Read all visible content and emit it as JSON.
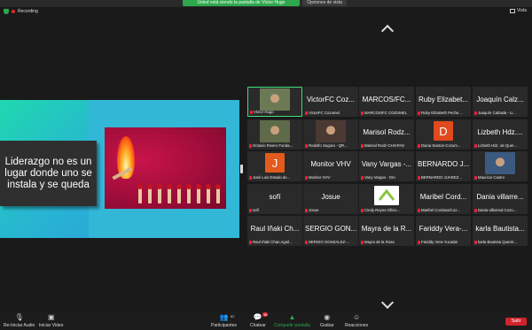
{
  "top": {
    "share_banner": "Usted está viendo la pantalla de Víctor Hugo",
    "view_options": "Opciones de vista",
    "recording": "Recording",
    "view": "Vista"
  },
  "shared_screen": {
    "quote": "Liderazgo no es un lugar donde uno se instala y se queda"
  },
  "participants": [
    {
      "big": "",
      "cap": "Víctor Hugo",
      "type": "video",
      "active": true,
      "color": "#6b7a55"
    },
    {
      "big": "VictorFC Coz...",
      "cap": "VictorFC Cozumel",
      "type": "name"
    },
    {
      "big": "MARCOS/FC...",
      "cap": "MARCOS/FC COZUMEL",
      "type": "name"
    },
    {
      "big": "Ruby Elizabet...",
      "cap": "Ruby Elizabeth Peche...",
      "type": "name"
    },
    {
      "big": "Joaquín Calz...",
      "cap": "Joaquín Calzada - U...",
      "type": "name"
    },
    {
      "big": "",
      "cap": "Octavio Rivero Funda...",
      "type": "video",
      "color": "#5e6a4a"
    },
    {
      "big": "",
      "cap": "Rodolfo Segura - QR...",
      "type": "video",
      "color": "#4a3a33"
    },
    {
      "big": "Marisol Rodz...",
      "cap": "Marisol Rodz-CHIAPAS",
      "type": "name"
    },
    {
      "big": "",
      "cap": "Diana Santos-Cozum...",
      "type": "avatar",
      "letter": "D",
      "color": "#e04a1c"
    },
    {
      "big": "Lizbeth Hdz....",
      "cap": "Lizbeth Hdz. de Quer...",
      "type": "name"
    },
    {
      "big": "",
      "cap": "José Luis Estado de...",
      "type": "avatar",
      "letter": "J",
      "color": "#e25a1c"
    },
    {
      "big": "Monitor VHV",
      "cap": "Monitor VHV",
      "type": "name"
    },
    {
      "big": "Vany Vargas -...",
      "cap": "Vany Vargas - Gto",
      "type": "name"
    },
    {
      "big": "BERNARDO J...",
      "cap": "BERNARDO JUAREZ...",
      "type": "name"
    },
    {
      "big": "",
      "cap": "Mauricio Castro",
      "type": "video",
      "color": "#3c5a80"
    },
    {
      "big": "sofí",
      "cap": "sofí",
      "type": "name"
    },
    {
      "big": "Josue",
      "cap": "Josue",
      "type": "name"
    },
    {
      "big": "",
      "cap": "Cindy Reyes Oficio...",
      "type": "logo",
      "color": "#8bc540"
    },
    {
      "big": "Maribel Cord...",
      "cap": "Maribel Cordova/Coz...",
      "type": "name"
    },
    {
      "big": "Dania villarre...",
      "cap": "Dania villarreal Cozu...",
      "type": "name"
    },
    {
      "big": "Raul Iñaki Ch...",
      "cap": "Raul Iñaki Chan Aguil...",
      "type": "name"
    },
    {
      "big": "SERGIO GON...",
      "cap": "SERGIO GONZALEZ-...",
      "type": "name"
    },
    {
      "big": "Mayra de la R...",
      "cap": "Mayra de la Rosa",
      "type": "name"
    },
    {
      "big": "Fariddy Vera-...",
      "cap": "Fariddy Vera-Yucatán",
      "type": "name"
    },
    {
      "big": "karla Bautista...",
      "cap": "karla Bautista Queret...",
      "type": "name"
    }
  ],
  "toolbar": {
    "audio": "Re-Iniciar Audio",
    "video": "Iniciar Video",
    "participants": "Participantes",
    "participants_count": "82",
    "chat": "Chatear",
    "chat_badge": "16",
    "share": "Compartir pantalla",
    "record": "Grabar",
    "reactions": "Reacciones",
    "leave": "Salir"
  }
}
